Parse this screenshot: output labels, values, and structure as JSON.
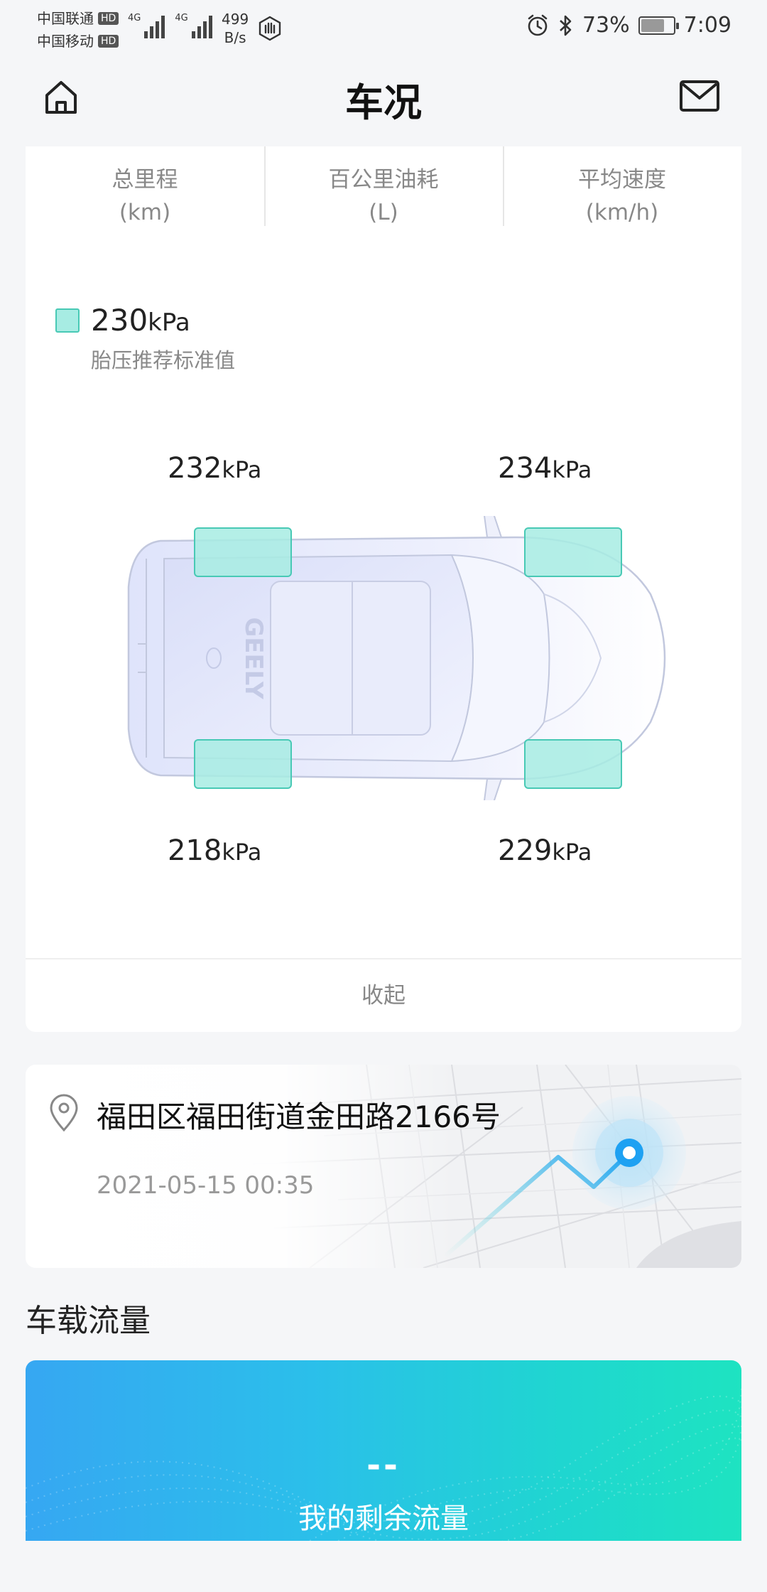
{
  "status_bar": {
    "carrier_1": "中国联通",
    "carrier_2": "中国移动",
    "hd_badge": "HD",
    "network_type": "4G",
    "net_speed_value": "499",
    "net_speed_unit": "B/s",
    "battery_percent": "73%",
    "battery_level": 0.73,
    "time": "7:09"
  },
  "header": {
    "title": "车况"
  },
  "stats": [
    {
      "label": "总里程",
      "unit": "(km)"
    },
    {
      "label": "百公里油耗",
      "unit": "(L)"
    },
    {
      "label": "平均速度",
      "unit": "(km/h)"
    }
  ],
  "tire_pressure": {
    "recommended_value": "230",
    "unit": "kPa",
    "recommended_label": "胎压推荐标准值",
    "rear_left": "232",
    "front_left": "234",
    "rear_right": "218",
    "front_right": "229"
  },
  "collapse_label": "收起",
  "location": {
    "address": "福田区福田街道金田路2166号",
    "timestamp": "2021-05-15 00:35"
  },
  "data_flow": {
    "section_title": "车载流量",
    "remaining_value": "--",
    "remaining_label": "我的剩余流量"
  },
  "colors": {
    "tire_fill": "#a7ece3",
    "tire_stroke": "#48c9b5",
    "accent_blue": "#1ea1f2",
    "flow_gradient_start": "#36a7f2",
    "flow_gradient_end": "#1ee3c1"
  }
}
